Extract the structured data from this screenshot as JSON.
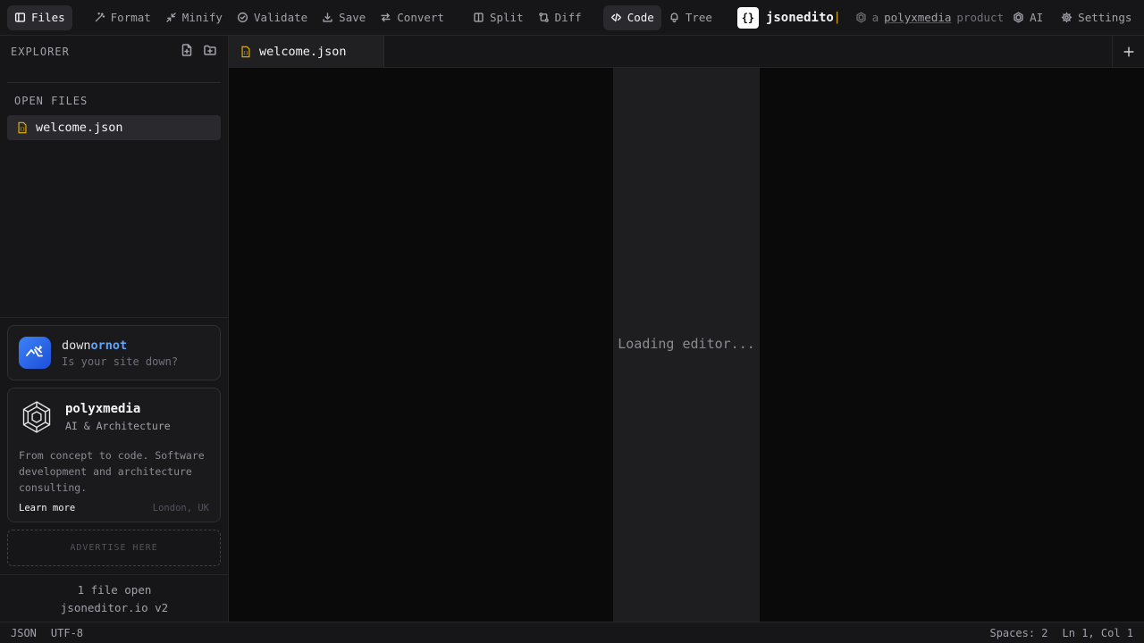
{
  "toolbar": {
    "files": "Files",
    "format": "Format",
    "minify": "Minify",
    "validate": "Validate",
    "save": "Save",
    "convert": "Convert",
    "split": "Split",
    "diff": "Diff",
    "code": "Code",
    "tree": "Tree",
    "brand_logo": "{}",
    "brand_name": "jsonedito",
    "brand_cursor": "|",
    "byline_prefix": "a",
    "byline_link": "polyxmedia",
    "byline_suffix": "product",
    "ai": "AI",
    "settings": "Settings"
  },
  "sidebar": {
    "explorer_title": "EXPLORER",
    "open_files_title": "OPEN FILES",
    "files": [
      "welcome.json"
    ],
    "downornot": {
      "name_a": "down",
      "name_b": "ornot",
      "tagline": "Is your site down?"
    },
    "polyxmedia": {
      "name": "polyxmedia",
      "subtitle": "AI & Architecture",
      "description": "From concept to code. Software development and architecture consulting.",
      "learn_more": "Learn more",
      "location": "London, UK"
    },
    "advertise": "ADVERTISE HERE",
    "footer_count": "1 file open",
    "footer_version": "jsoneditor.io v2"
  },
  "tabs": [
    {
      "label": "welcome.json"
    }
  ],
  "editor": {
    "loading": "Loading editor..."
  },
  "statusbar": {
    "language": "JSON",
    "encoding": "UTF-8",
    "spaces": "Spaces: 2",
    "cursor": "Ln 1, Col 1"
  },
  "colors": {
    "accent_yellow": "#eab308",
    "accent_blue": "#3b82f6",
    "background": "#0a0a0b",
    "panel": "#161618"
  }
}
